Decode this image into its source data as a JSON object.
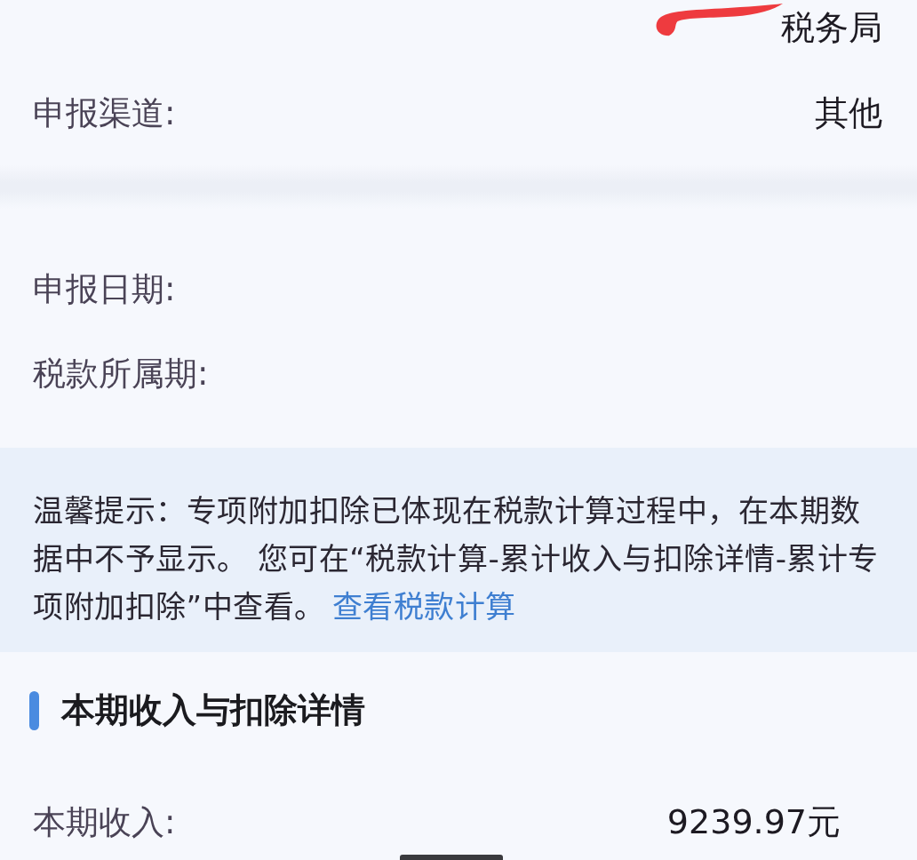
{
  "office": {
    "text": "税务局",
    "redacted": true
  },
  "channel_row": {
    "label": "申报渠道:",
    "value": "其他"
  },
  "date_rows": [
    {
      "label": "申报日期:"
    },
    {
      "label": "税款所属期:"
    }
  ],
  "tip": {
    "text": "温馨提示：专项附加扣除已体现在税款计算过程中，在本期数据中不予显示。 您可在“税款计算-累计收入与扣除详情-累计专项附加扣除”中查看。",
    "link": "查看税款计算"
  },
  "section": {
    "title": "本期收入与扣除详情",
    "rows": [
      {
        "label": "本期收入:",
        "value": "9239.97元"
      }
    ]
  }
}
